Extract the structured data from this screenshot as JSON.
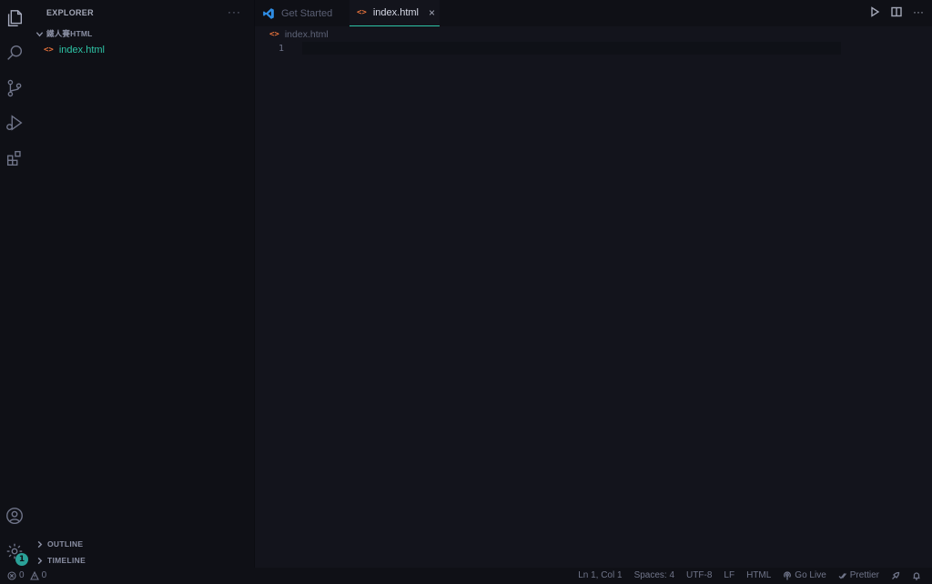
{
  "explorer": {
    "title": "EXPLORER",
    "more_label": "···",
    "folder_name": "鐵人賽HTML",
    "files": [
      {
        "name": "index.html",
        "glyph": "<>"
      }
    ],
    "sections": [
      {
        "label": "OUTLINE"
      },
      {
        "label": "TIMELINE"
      }
    ]
  },
  "activity_bar": {
    "icons": [
      "files-icon",
      "search-icon",
      "source-control-icon",
      "run-debug-icon",
      "extensions-icon",
      "account-icon",
      "settings-gear-icon"
    ],
    "settings_badge": "1"
  },
  "tabs": [
    {
      "label": "Get Started",
      "active": false
    },
    {
      "label": "index.html",
      "active": true,
      "close": "×"
    }
  ],
  "breadcrumb": {
    "file": "index.html"
  },
  "editor": {
    "line_numbers": [
      "1"
    ]
  },
  "status": {
    "errors": "0",
    "warnings": "0",
    "position": "Ln 1, Col 1",
    "spaces": "Spaces: 4",
    "encoding": "UTF-8",
    "eol": "LF",
    "language": "HTML",
    "golive": "Go Live",
    "prettier": "Prettier"
  },
  "colors": {
    "accent": "#2ec4a6",
    "html_glyph": "#e8733c",
    "background": "#13141c",
    "sidebar": "#0f1016"
  }
}
